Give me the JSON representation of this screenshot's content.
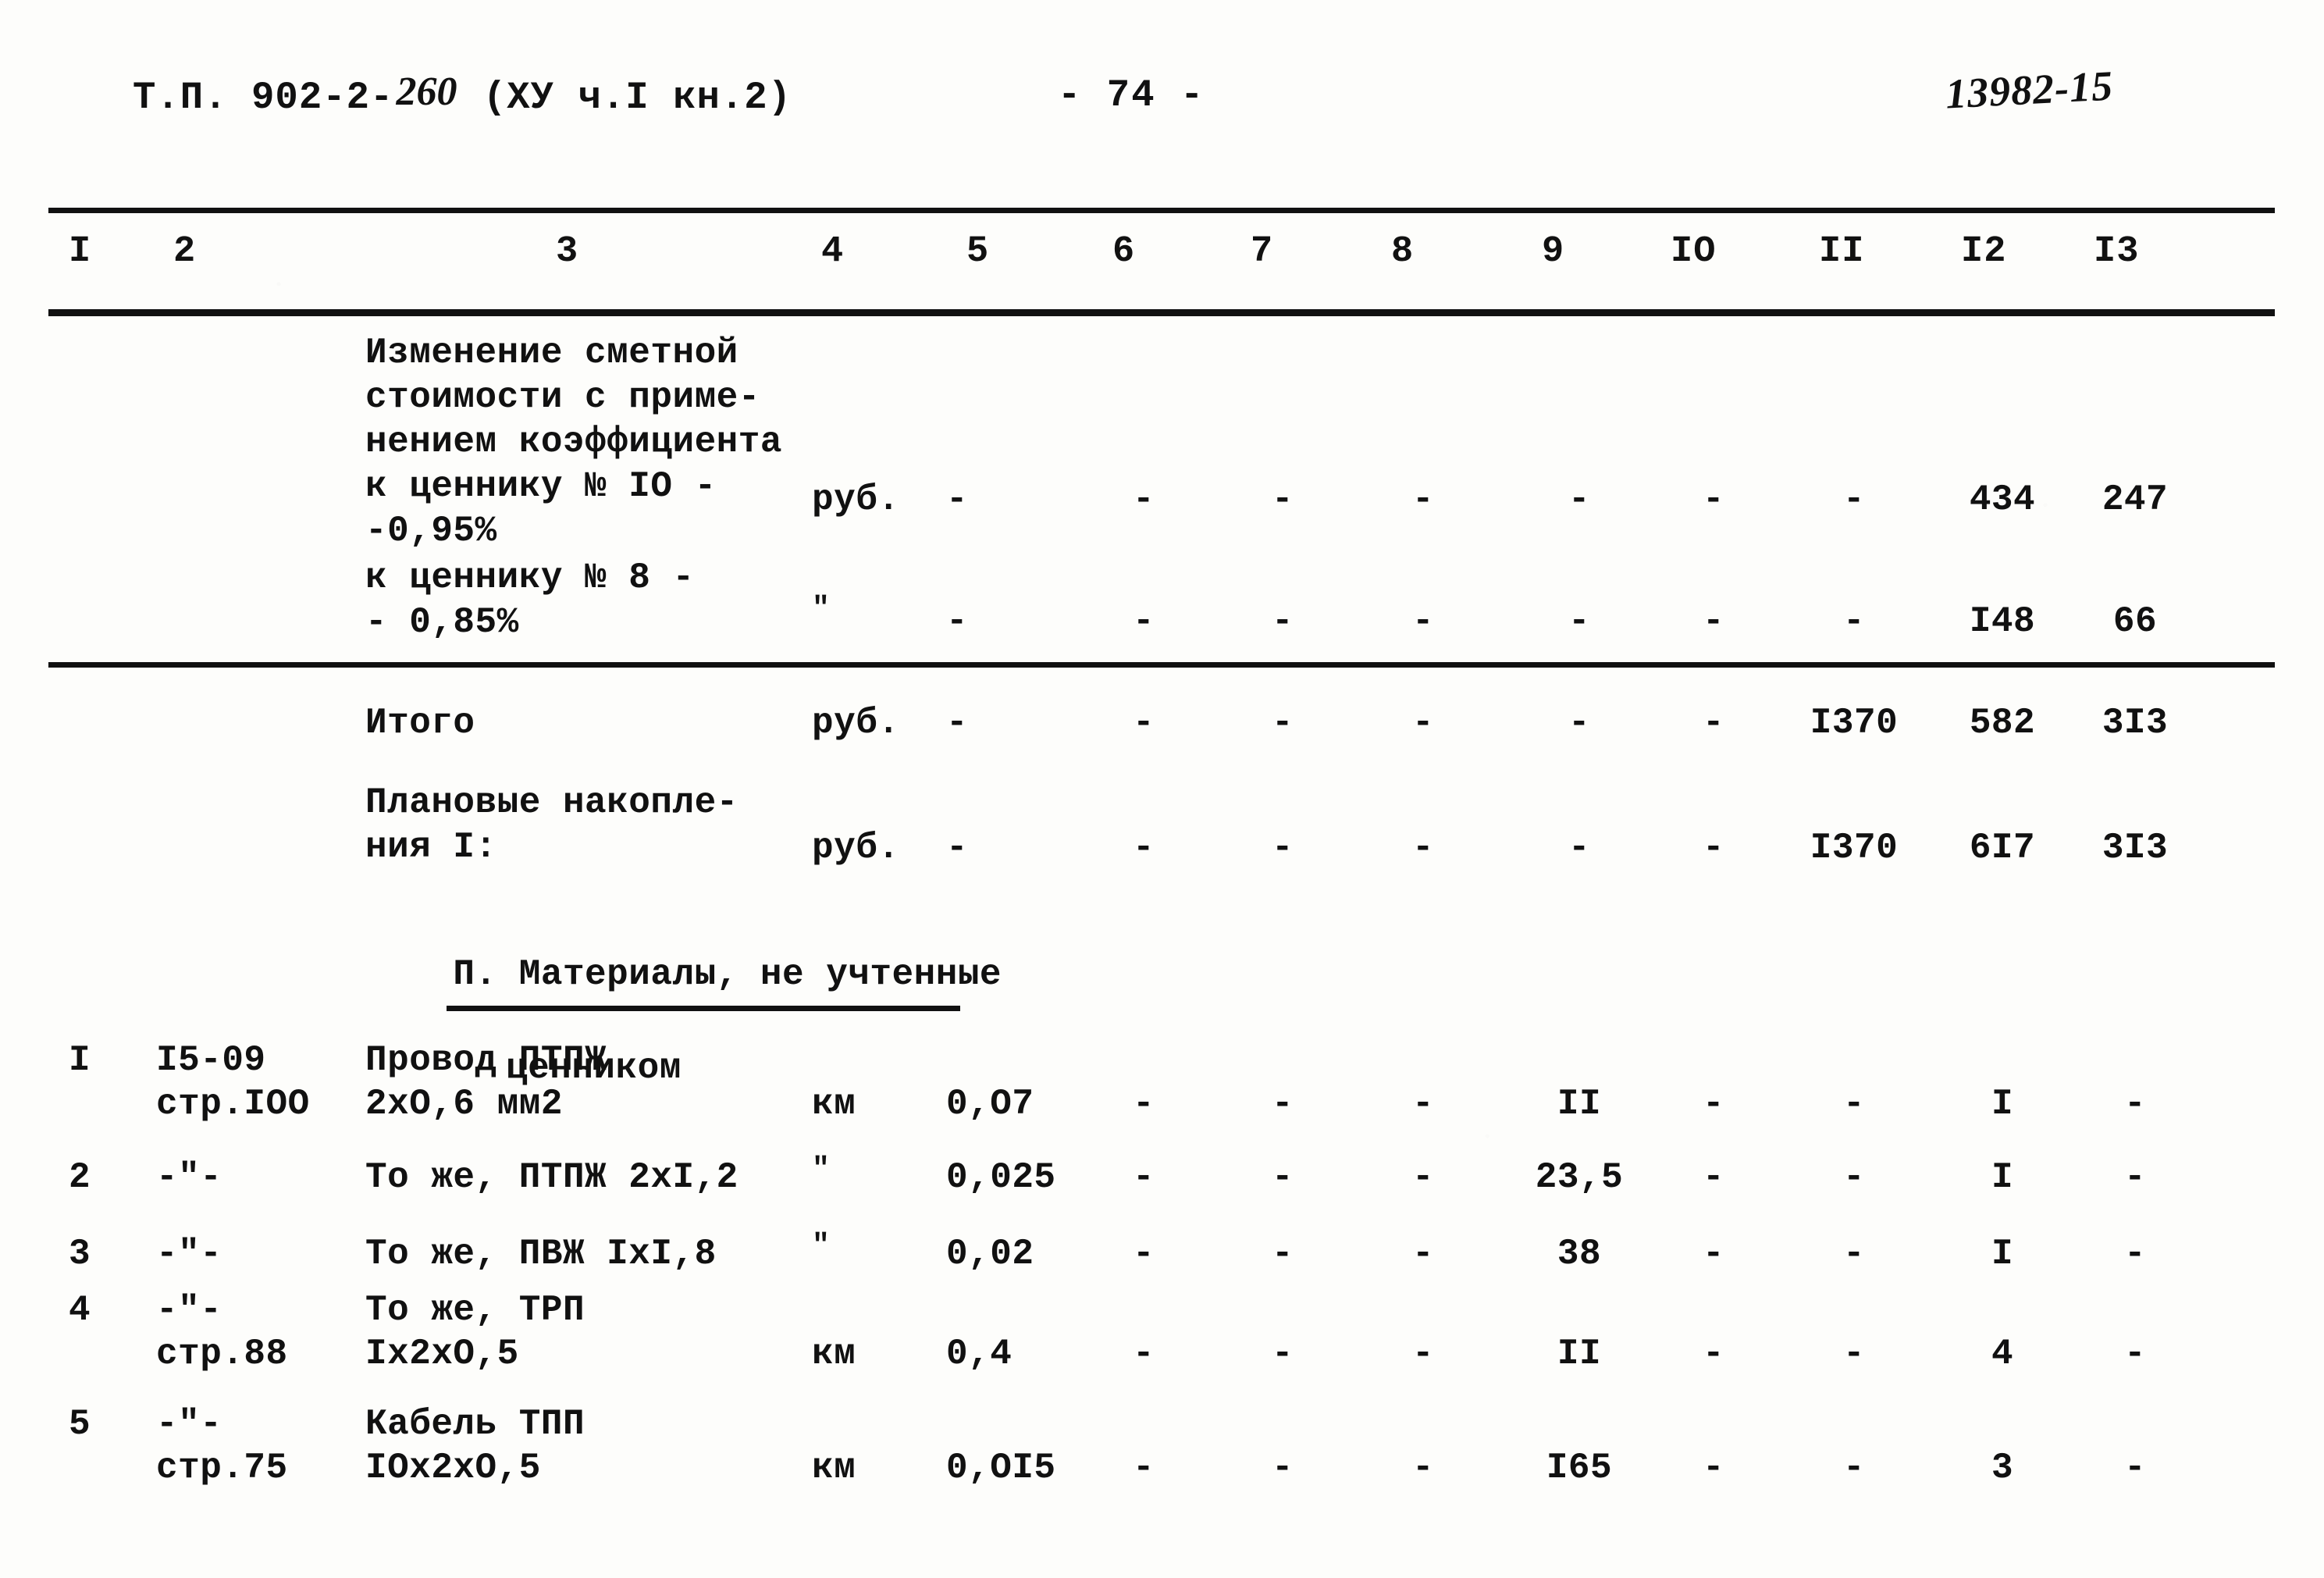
{
  "header": {
    "doc_code_prefix": "Т.П. 902-2-",
    "doc_code_hand": "260",
    "doc_code_suffix": " (ХУ ч.I кн.2)",
    "page_number": "- 74 -",
    "archive_number": "13982-15"
  },
  "columns": [
    "I",
    "2",
    "3",
    "4",
    "5",
    "6",
    "7",
    "8",
    "9",
    "IO",
    "II",
    "I2",
    "I3"
  ],
  "blocks": {
    "coeff_10": {
      "text_lines": "Изменение сметной\nстоимости с приме-\nнением коэффициента\nк ценнику № IO -\n-0,95%",
      "unit": "руб.",
      "c5": "-",
      "c6": "-",
      "c7": "-",
      "c8": "-",
      "c9": "-",
      "c10": "-",
      "c11": "-",
      "c12": "434",
      "c13": "247"
    },
    "coeff_8": {
      "text_lines": "к ценнику № 8 -\n- 0,85%",
      "unit": "\"",
      "c5": "-",
      "c6": "-",
      "c7": "-",
      "c8": "-",
      "c9": "-",
      "c10": "-",
      "c11": "-",
      "c12": "I48",
      "c13": "66"
    },
    "itogo": {
      "text_lines": "Итого",
      "unit": "руб.",
      "c5": "-",
      "c6": "-",
      "c7": "-",
      "c8": "-",
      "c9": "-",
      "c10": "-",
      "c11": "I370",
      "c12": "582",
      "c13": "3I3"
    },
    "planovye": {
      "text_lines": "Плановые накопле-\nния I:",
      "unit": "руб.",
      "c5": "-",
      "c6": "-",
      "c7": "-",
      "c8": "-",
      "c9": "-",
      "c10": "-",
      "c11": "I370",
      "c12": "6I7",
      "c13": "3I3"
    }
  },
  "section": {
    "line1": "П. Материалы, не учтенные",
    "line2": "ценником"
  },
  "materials": [
    {
      "c1": "I",
      "c2": "I5-09\nстр.IOO",
      "c3": "Провод ПТПЖ\n2хO,6 мм2",
      "c4": "км",
      "c5": "0,O7",
      "c6": "-",
      "c7": "-",
      "c8": "-",
      "c9": "II",
      "c10": "-",
      "c11": "-",
      "c12": "I",
      "c13": "-"
    },
    {
      "c1": "2",
      "c2": "-\"-",
      "c3": "То же, ПТПЖ 2хI,2",
      "c4": "\"",
      "c5": "0,025",
      "c6": "-",
      "c7": "-",
      "c8": "-",
      "c9": "23,5",
      "c10": "-",
      "c11": "-",
      "c12": "I",
      "c13": "-"
    },
    {
      "c1": "3",
      "c2": "-\"-",
      "c3": "То же, ПВЖ IхI,8",
      "c4": "\"",
      "c5": "0,02",
      "c6": "-",
      "c7": "-",
      "c8": "-",
      "c9": "38",
      "c10": "-",
      "c11": "-",
      "c12": "I",
      "c13": "-"
    },
    {
      "c1": "4",
      "c2": "-\"-\nстр.88",
      "c3": "То же, ТРП\nIх2хO,5",
      "c4": "км",
      "c5": "0,4",
      "c6": "-",
      "c7": "-",
      "c8": "-",
      "c9": "II",
      "c10": "-",
      "c11": "-",
      "c12": "4",
      "c13": "-"
    },
    {
      "c1": "5",
      "c2": "-\"-\nстр.75",
      "c3": "Кабель ТПП\nIOх2хO,5",
      "c4": "км",
      "c5": "0,OI5",
      "c6": "-",
      "c7": "-",
      "c8": "-",
      "c9": "I65",
      "c10": "-",
      "c11": "-",
      "c12": "3",
      "c13": "-"
    }
  ]
}
